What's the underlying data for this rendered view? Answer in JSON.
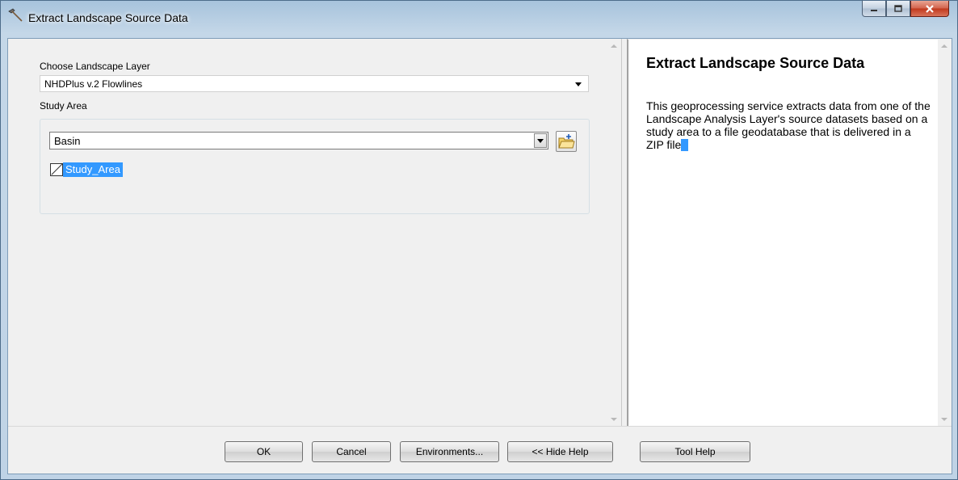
{
  "window": {
    "title": "Extract Landscape Source Data",
    "caption_buttons": [
      "minimize",
      "maximize",
      "close"
    ]
  },
  "form": {
    "landscape_layer_label": "Choose Landscape Layer",
    "landscape_layer_value": "NHDPlus v.2 Flowlines",
    "study_area_label": "Study Area",
    "study_area_combo_value": "Basin",
    "study_area_layer_name": "Study_Area"
  },
  "help": {
    "title": "Extract Landscape Source Data",
    "body": "This geoprocessing service extracts data from one of the Landscape Analysis Layer's source datasets based on a study area to a file geodatabase that is delivered in a ZIP file"
  },
  "buttons": {
    "ok": "OK",
    "cancel": "Cancel",
    "environments": "Environments...",
    "hide_help": "<< Hide Help",
    "tool_help": "Tool Help"
  },
  "colors": {
    "selection": "#3399ff",
    "title_glass": "#bfd3e6",
    "close_button": "#c0381c"
  },
  "icons": [
    "hammer-icon",
    "minimize-icon",
    "maximize-icon",
    "close-icon",
    "dropdown-arrow-icon",
    "add-data-folder-icon",
    "polygon-layer-icon",
    "scroll-up-icon",
    "scroll-down-icon"
  ]
}
